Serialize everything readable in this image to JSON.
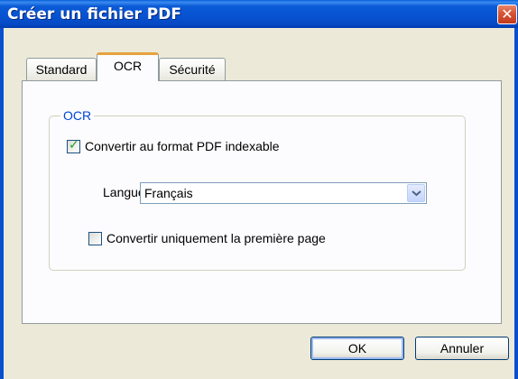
{
  "window": {
    "title": "Créer un fichier PDF",
    "close_icon": "close-icon"
  },
  "tabs": [
    {
      "label": "Standard",
      "active": false
    },
    {
      "label": "OCR",
      "active": true
    },
    {
      "label": "Sécurité",
      "active": false
    }
  ],
  "ocr_group": {
    "legend": "OCR",
    "convert_indexable": {
      "label": "Convertir au format PDF indexable",
      "checked": true
    },
    "language": {
      "label": "Langue :",
      "value": "Français"
    },
    "first_page_only": {
      "label": "Convertir uniquement la première page",
      "checked": false
    }
  },
  "buttons": {
    "ok": "OK",
    "cancel": "Annuler"
  },
  "colors": {
    "titlebar": "#0752d1",
    "accent_tab": "#e6a23c",
    "group_legend": "#0046d5",
    "check": "#21a121"
  }
}
